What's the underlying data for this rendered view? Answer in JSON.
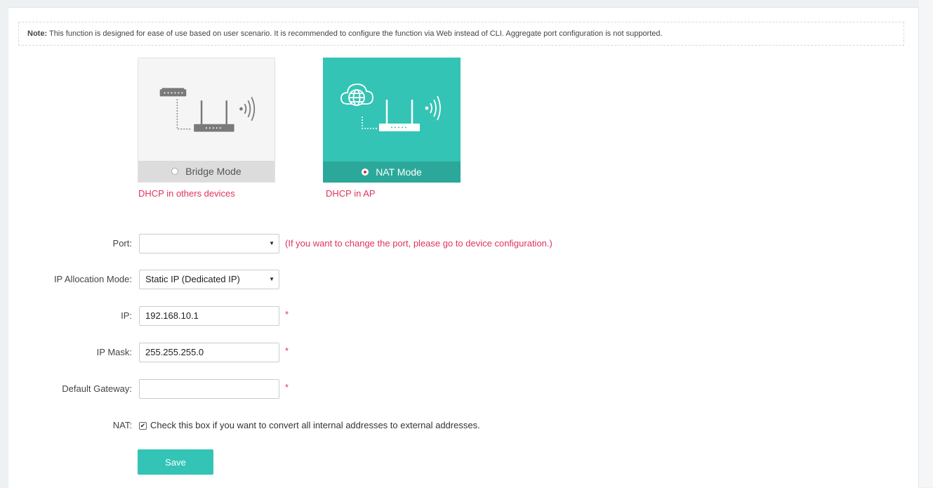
{
  "note": {
    "label": "Note:",
    "text": "This function is designed for ease of use based on user scenario. It is recommended to configure the function via Web instead of CLI. Aggregate port configuration is not supported."
  },
  "modes": [
    {
      "label": "Bridge Mode",
      "caption": "DHCP in others devices",
      "selected": false
    },
    {
      "label": "NAT Mode",
      "caption": "DHCP in AP",
      "selected": true
    }
  ],
  "form": {
    "port": {
      "label": "Port:",
      "value": "",
      "hint": "(If you want to change the port, please go to device configuration.)"
    },
    "ip_mode": {
      "label": "IP Allocation Mode:",
      "value": "Static IP (Dedicated IP)"
    },
    "ip": {
      "label": "IP:",
      "value": "192.168.10.1",
      "required": "*"
    },
    "mask": {
      "label": "IP Mask:",
      "value": "255.255.255.0",
      "required": "*"
    },
    "gateway": {
      "label": "Default Gateway:",
      "value": "",
      "required": "*"
    },
    "nat": {
      "label": "NAT:",
      "checked": true,
      "text": "Check this box if you want to convert all internal addresses to external addresses."
    }
  },
  "save_label": "Save",
  "colors": {
    "accent": "#34c4b5",
    "accent_dark": "#2ca89b",
    "warning": "#e0335a"
  }
}
